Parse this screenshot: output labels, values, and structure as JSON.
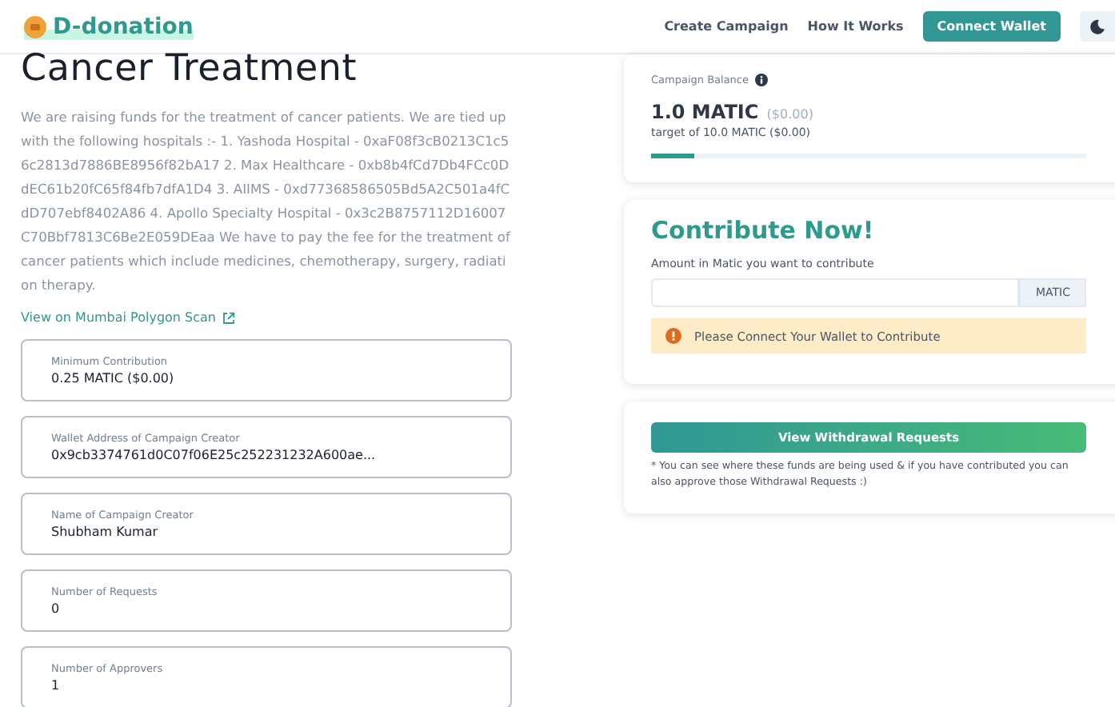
{
  "header": {
    "logo": "D-donation",
    "nav": [
      "Create Campaign",
      "How It Works"
    ],
    "connect_button": "Connect Wallet"
  },
  "campaign": {
    "title": "Cancer Treatment",
    "description": "We are raising funds for the treatment of cancer patients. We are tied up with the following hospitals :- 1. Yashoda Hospital - 0xaF08f3cB0213C1c56c2813d7886BE8956f82bA17 2. Max Healthcare - 0xb8b4fCd7Db4FCc0DdEC61b20fC65f84fb7dfA1D4 3. AIIMS - 0xd77368586505Bd5A2C501a4fCdD707ebf8402A86 4. Apollo Specialty Hospital - 0x3c2B8757112D16007C70Bbf7813C6Be2E059DEaa We have to pay the fee for the treatment of cancer patients which include medicines, chemotherapy, surgery, radiation therapy.",
    "link": "View on Mumbai Polygon Scan"
  },
  "stats": [
    {
      "label": "Minimum Contribution",
      "value": "0.25 MATIC ($0.00)"
    },
    {
      "label": "Wallet Address of Campaign Creator",
      "value": "0x9cb3374761d0C07f06E25c252231232A600ae..."
    },
    {
      "label": "Name of Campaign Creator",
      "value": "Shubham Kumar"
    },
    {
      "label": "Number of Requests",
      "value": "0"
    },
    {
      "label": "Number of Approvers",
      "value": "1"
    }
  ],
  "balance": {
    "label": "Campaign Balance",
    "amount": "1.0 MATIC",
    "amount_usd": "($0.00)",
    "target": "target of 10.0 MATIC ($0.00)",
    "level": 0.1
  },
  "contribute": {
    "title": "Contribute Now!",
    "label": "Amount in Matic you want to contribute",
    "unit": "MATIC",
    "alert": "Please Connect Your Wallet to Contribute"
  },
  "withdrawal": {
    "button": "View Withdrawal Requests",
    "note": "* You can see where these funds are being used & if you have contributed you can also approve those Withdrawal Requests :)"
  }
}
